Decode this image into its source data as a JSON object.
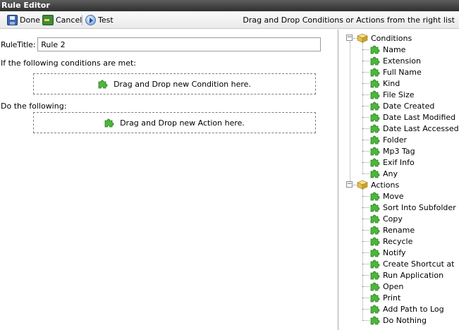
{
  "window": {
    "title": "Rule Editor"
  },
  "toolbar": {
    "done_label": "Done",
    "cancel_label": "Cancel",
    "test_label": "Test",
    "hint": "Drag and Drop Conditions or Actions from the right list"
  },
  "editor": {
    "rule_title_label": "RuleTitle:",
    "rule_title_value": "Rule 2",
    "conditions_label": "If the following conditions are met:",
    "condition_drop_text": "Drag and Drop new Condition here.",
    "actions_label": "Do the following:",
    "action_drop_text": "Drag and Drop new Action here."
  },
  "tree": {
    "conditions": {
      "label": "Conditions",
      "items": [
        "Name",
        "Extension",
        "Full Name",
        "Kind",
        "File Size",
        "Date Created",
        "Date Last Modified",
        "Date Last Accessed",
        "Folder",
        "Mp3 Tag",
        "Exif Info",
        "Any"
      ]
    },
    "actions": {
      "label": "Actions",
      "items": [
        "Move",
        "Sort Into Subfolder",
        "Copy",
        "Rename",
        "Recycle",
        "Notify",
        "Create Shortcut at",
        "Run Application",
        "Open",
        "Print",
        "Add Path to Log",
        "Do Nothing"
      ]
    }
  },
  "colors": {
    "puzzle_green": "#4cb83a",
    "folder_gold": "#e6c14a",
    "titlebar": "#3a3a3a"
  }
}
